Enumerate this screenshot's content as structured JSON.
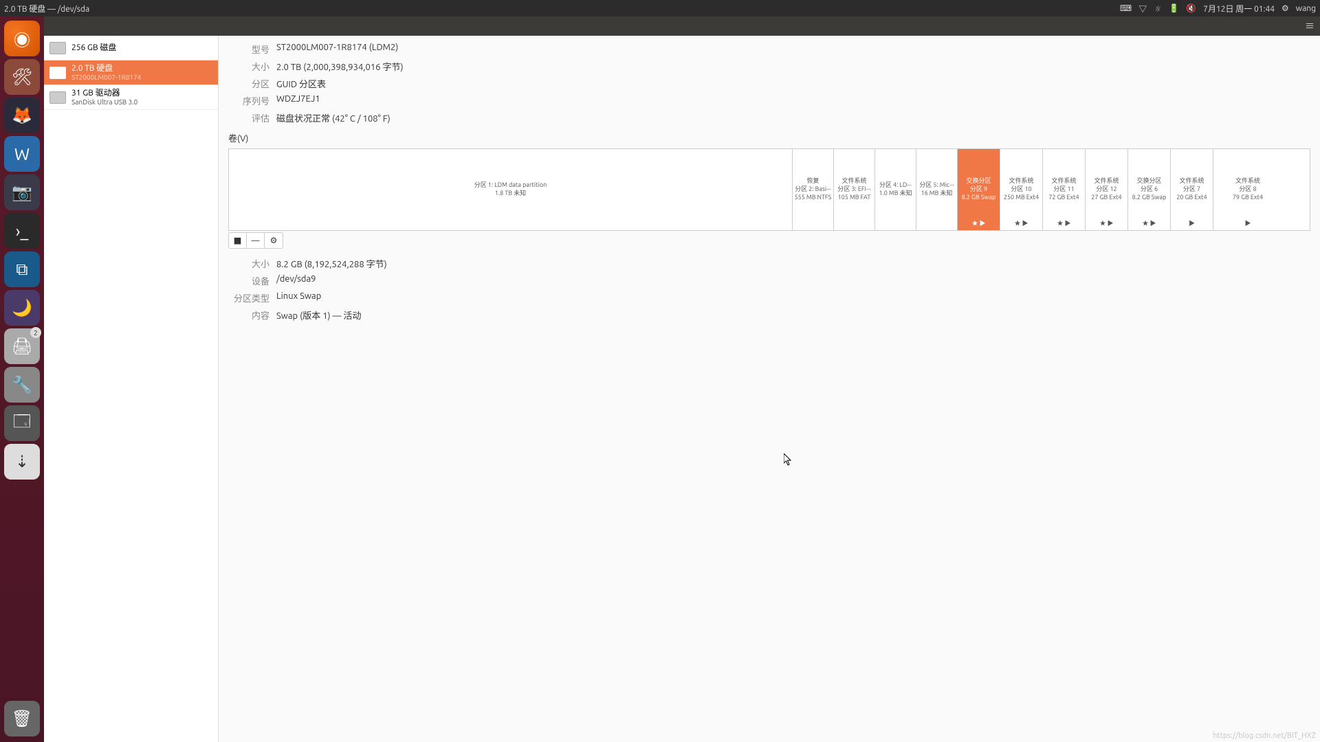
{
  "panel": {
    "title": "2.0 TB 硬盘 — /dev/sda",
    "datetime": "7月12日 周一 01:44",
    "user": "wang",
    "sound_muted": true
  },
  "launcher": {
    "printer_badge": "2"
  },
  "devices": [
    {
      "name": "256 GB 磁盘",
      "sub": ""
    },
    {
      "name": "2.0 TB 硬盘",
      "sub": "ST2000LM007-1R8174",
      "selected": true
    },
    {
      "name": "31 GB 驱动器",
      "sub": "SanDisk Ultra USB 3.0"
    }
  ],
  "disk_info": {
    "labels": {
      "model": "型号",
      "size": "大小",
      "part": "分区",
      "serial": "序列号",
      "assess": "评估"
    },
    "model": "ST2000LM007-1R8174 (LDM2)",
    "size": "2.0 TB (2,000,398,934,016 字节)",
    "partitioning": "GUID 分区表",
    "serial": "WDZJ7EJ1",
    "assessment": "磁盘状况正常 (42° C / 108° F)"
  },
  "volumes_title": "卷(V)",
  "partitions": [
    {
      "flex": 820,
      "lines": [
        "分区 1:  LDM data partition",
        "1.8 TB 未知"
      ],
      "footer": ""
    },
    {
      "flex": 60,
      "lines": [
        "恢复",
        "分区 2:  Basi···",
        "555 MB NTFS"
      ],
      "footer": ""
    },
    {
      "flex": 60,
      "lines": [
        "文件系统",
        "分区 3:  EFI···",
        "105 MB FAT"
      ],
      "footer": ""
    },
    {
      "flex": 60,
      "lines": [
        "分区 4:  LD···",
        "1.0 MB 未知"
      ],
      "footer": ""
    },
    {
      "flex": 60,
      "lines": [
        "分区 5:  Mic···",
        "16 MB 未知"
      ],
      "footer": ""
    },
    {
      "flex": 62,
      "lines": [
        "交换分区",
        "分区 9",
        "8.2 GB Swap"
      ],
      "footer": "★ ▶",
      "selected": true
    },
    {
      "flex": 62,
      "lines": [
        "文件系统",
        "分区 10",
        "250 MB Ext4"
      ],
      "footer": "★ ▶"
    },
    {
      "flex": 62,
      "lines": [
        "文件系统",
        "分区 11",
        "72 GB Ext4"
      ],
      "footer": "★ ▶"
    },
    {
      "flex": 62,
      "lines": [
        "文件系统",
        "分区 12",
        "27 GB Ext4"
      ],
      "footer": "★ ▶"
    },
    {
      "flex": 62,
      "lines": [
        "交换分区",
        "分区 6",
        "8.2 GB Swap"
      ],
      "footer": "★ ▶"
    },
    {
      "flex": 62,
      "lines": [
        "文件系统",
        "分区 7",
        "20 GB Ext4"
      ],
      "footer": "▶"
    },
    {
      "flex": 100,
      "lines": [
        "文件系统",
        "分区 8",
        "79 GB Ext4"
      ],
      "footer": "▶"
    }
  ],
  "toolbar": {
    "stop": "■",
    "minus": "—",
    "gear": "⚙"
  },
  "selected_partition": {
    "labels": {
      "size": "大小",
      "device": "设备",
      "type": "分区类型",
      "content": "内容"
    },
    "size": "8.2 GB (8,192,524,288 字节)",
    "device": "/dev/sda9",
    "type": "Linux Swap",
    "content": "Swap (版本 1) — 活动"
  },
  "watermark": "https://blog.csdn.net/BIT_HXZ"
}
